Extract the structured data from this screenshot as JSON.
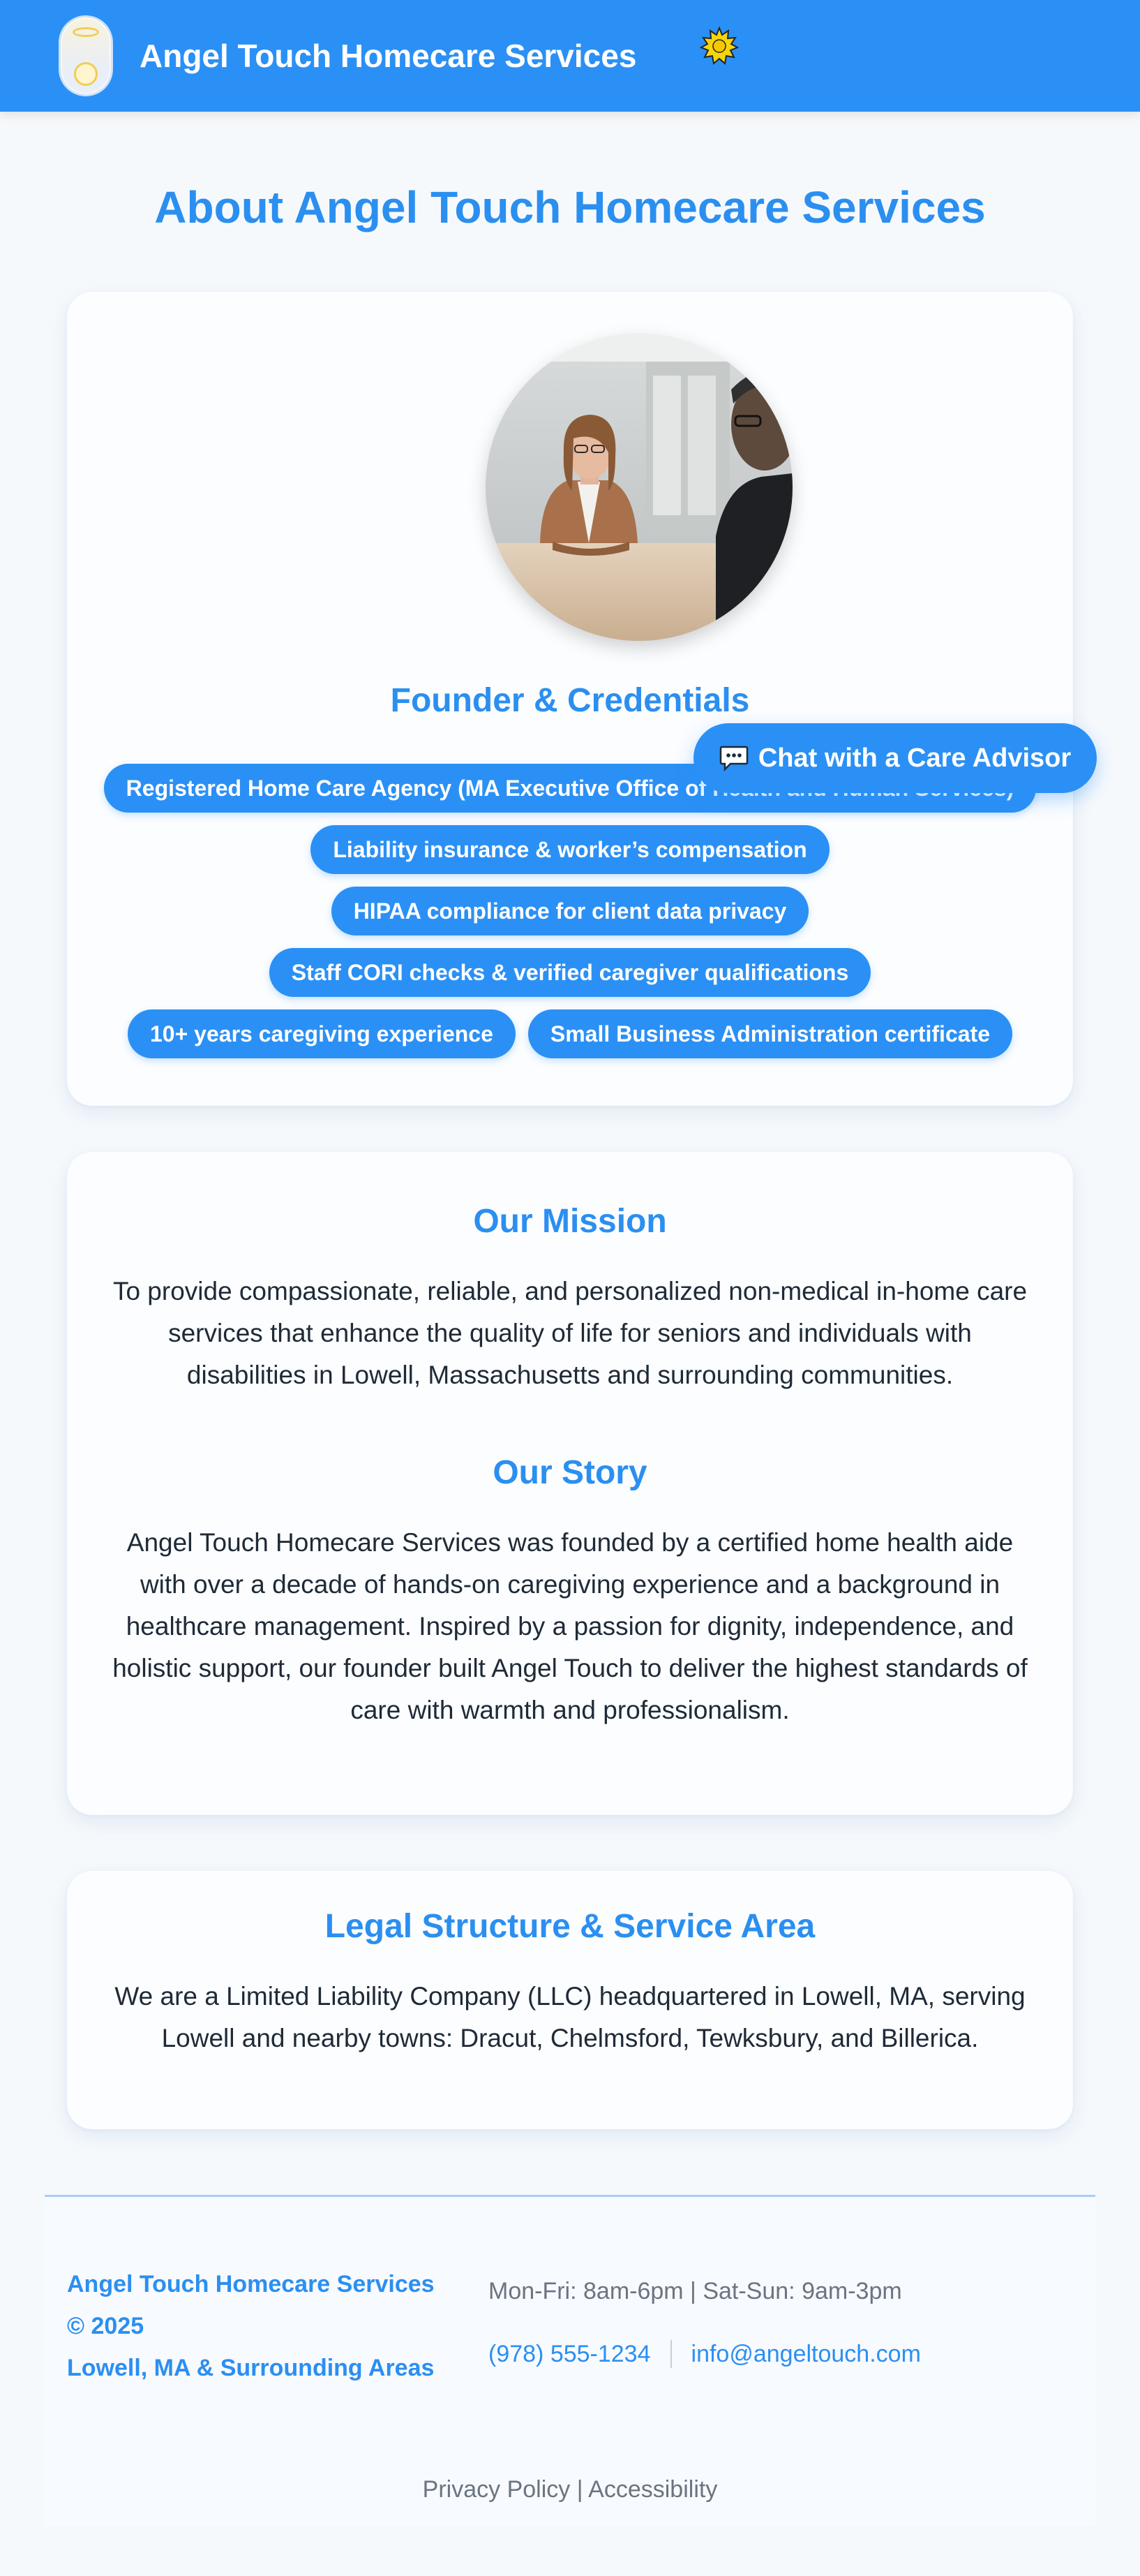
{
  "header": {
    "site_title": "Angel Touch Homecare Services",
    "logo_icon": "angel-logo-icon",
    "badge_icon": "sun-icon",
    "brand_color": "#2b90f5"
  },
  "page": {
    "title": "About Angel Touch Homecare Services"
  },
  "founder": {
    "heading": "Founder & Credentials",
    "credentials": [
      "Registered Home Care Agency (MA Executive Office of Health and Human Services)",
      "Liability insurance & worker’s compensation",
      "HIPAA compliance for client data privacy",
      "Staff CORI checks & verified caregiver qualifications",
      "10+ years caregiving experience",
      "Small Business Administration certificate"
    ]
  },
  "chat": {
    "label": "Chat with a Care Advisor",
    "icon": "chat-bubble-icon"
  },
  "mission": {
    "heading": "Our Mission",
    "text": "To provide compassionate, reliable, and personalized non-medical in-home care services that enhance the quality of life for seniors and individuals with disabilities in Lowell, Massachusetts and surrounding communities."
  },
  "story": {
    "heading": "Our Story",
    "text": "Angel Touch Homecare Services was founded by a certified home health aide with over a decade of hands-on caregiving experience and a background in healthcare management. Inspired by a passion for dignity, independence, and holistic support, our founder built Angel Touch to deliver the highest standards of care with warmth and professionalism."
  },
  "legal": {
    "heading": "Legal Structure & Service Area",
    "text": "We are a Limited Liability Company (LLC) headquartered in Lowell, MA, serving Lowell and nearby towns: Dracut, Chelmsford, Tewksbury, and Billerica."
  },
  "footer": {
    "brand_line1": "Angel Touch Homecare Services",
    "brand_line2": "© 2025",
    "brand_line3": "Lowell, MA & Surrounding Areas",
    "hours": "Mon-Fri: 8am-6pm | Sat-Sun: 9am-3pm",
    "phone": "(978) 555-1234",
    "email": "info@angeltouch.com",
    "privacy": "Privacy Policy",
    "separator": "|",
    "accessibility": "Accessibility"
  }
}
